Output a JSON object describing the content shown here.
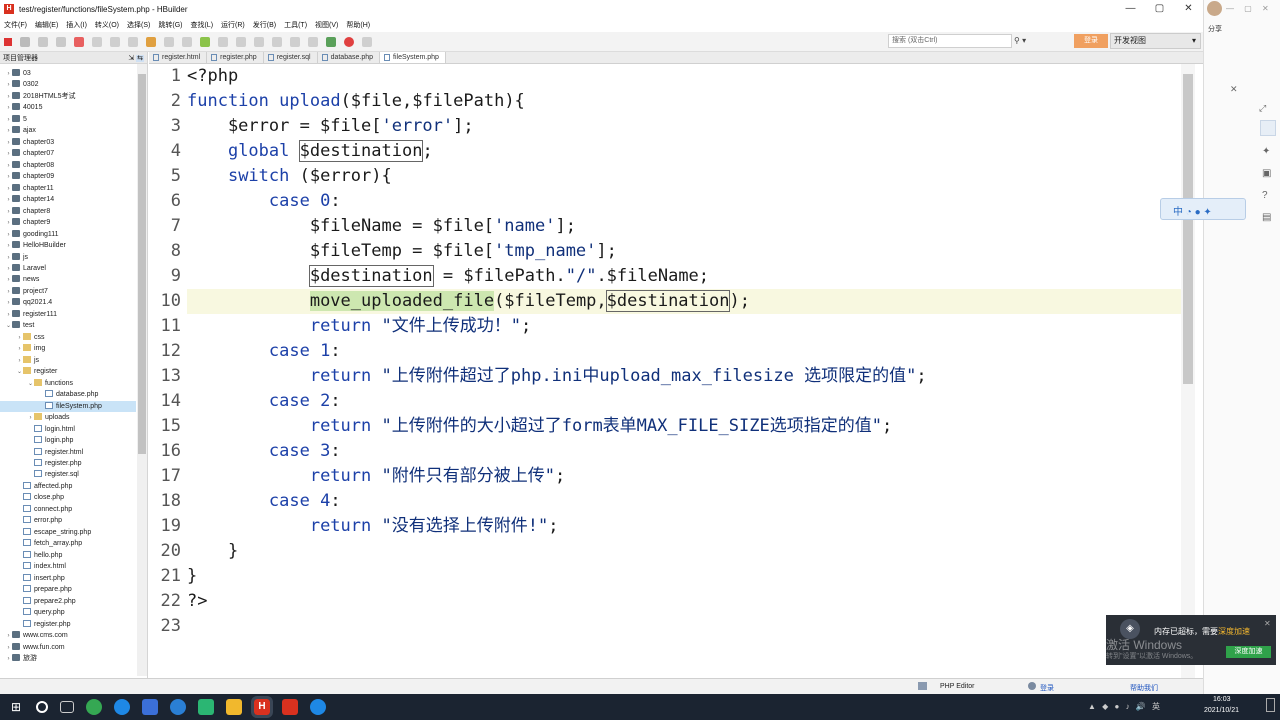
{
  "window": {
    "title": "test/register/functions/fileSystem.php - HBuilder",
    "app_icon": "H",
    "controls": [
      "—",
      "▢",
      "✕"
    ]
  },
  "menu": [
    "文件(F)",
    "编辑(E)",
    "插入(I)",
    "转义(O)",
    "选择(S)",
    "跳转(G)",
    "查找(L)",
    "运行(R)",
    "发行(B)",
    "工具(T)",
    "视图(V)",
    "帮助(H)"
  ],
  "toolbar": {
    "search_placeholder": "搜索 (双击Ctrl)",
    "login_label": "登录",
    "view_label": "开发视图"
  },
  "sidebar": {
    "title": "项目管理器",
    "items": [
      {
        "label": "03",
        "depth": 0,
        "kind": "proj",
        "arrow": "›"
      },
      {
        "label": "0302",
        "depth": 0,
        "kind": "proj",
        "arrow": "›"
      },
      {
        "label": "2018HTML5考试",
        "depth": 0,
        "kind": "proj",
        "arrow": "›"
      },
      {
        "label": "40015",
        "depth": 0,
        "kind": "proj",
        "arrow": "›"
      },
      {
        "label": "5",
        "depth": 0,
        "kind": "proj",
        "arrow": "›"
      },
      {
        "label": "ajax",
        "depth": 0,
        "kind": "proj",
        "arrow": "›"
      },
      {
        "label": "chapter03",
        "depth": 0,
        "kind": "proj",
        "arrow": "›"
      },
      {
        "label": "chapter07",
        "depth": 0,
        "kind": "proj",
        "arrow": "›"
      },
      {
        "label": "chapter08",
        "depth": 0,
        "kind": "proj",
        "arrow": "›"
      },
      {
        "label": "chapter09",
        "depth": 0,
        "kind": "proj",
        "arrow": "›"
      },
      {
        "label": "chapter11",
        "depth": 0,
        "kind": "proj",
        "arrow": "›"
      },
      {
        "label": "chapter14",
        "depth": 0,
        "kind": "proj",
        "arrow": "›"
      },
      {
        "label": "chapter8",
        "depth": 0,
        "kind": "proj",
        "arrow": "›"
      },
      {
        "label": "chapter9",
        "depth": 0,
        "kind": "proj",
        "arrow": "›"
      },
      {
        "label": "gooding111",
        "depth": 0,
        "kind": "proj",
        "arrow": "›"
      },
      {
        "label": "HelloHBuilder",
        "depth": 0,
        "kind": "proj",
        "arrow": "›"
      },
      {
        "label": "js",
        "depth": 0,
        "kind": "proj",
        "arrow": "›"
      },
      {
        "label": "Laravel",
        "depth": 0,
        "kind": "proj",
        "arrow": "›"
      },
      {
        "label": "news",
        "depth": 0,
        "kind": "proj",
        "arrow": "›"
      },
      {
        "label": "project7",
        "depth": 0,
        "kind": "proj",
        "arrow": "›"
      },
      {
        "label": "qq2021.4",
        "depth": 0,
        "kind": "proj",
        "arrow": "›"
      },
      {
        "label": "register111",
        "depth": 0,
        "kind": "proj",
        "arrow": "›"
      },
      {
        "label": "test",
        "depth": 0,
        "kind": "proj",
        "arrow": "⌄"
      },
      {
        "label": "css",
        "depth": 1,
        "kind": "folder",
        "arrow": "›"
      },
      {
        "label": "img",
        "depth": 1,
        "kind": "folder",
        "arrow": "›"
      },
      {
        "label": "js",
        "depth": 1,
        "kind": "folder",
        "arrow": "›"
      },
      {
        "label": "register",
        "depth": 1,
        "kind": "folder",
        "arrow": "⌄"
      },
      {
        "label": "functions",
        "depth": 2,
        "kind": "folder",
        "arrow": "⌄"
      },
      {
        "label": "database.php",
        "depth": 3,
        "kind": "file",
        "arrow": ""
      },
      {
        "label": "fileSystem.php",
        "depth": 3,
        "kind": "file",
        "arrow": "",
        "selected": true
      },
      {
        "label": "uploads",
        "depth": 2,
        "kind": "folder",
        "arrow": "›"
      },
      {
        "label": "login.html",
        "depth": 2,
        "kind": "file",
        "arrow": ""
      },
      {
        "label": "login.php",
        "depth": 2,
        "kind": "file",
        "arrow": ""
      },
      {
        "label": "register.html",
        "depth": 2,
        "kind": "file",
        "arrow": ""
      },
      {
        "label": "register.php",
        "depth": 2,
        "kind": "file",
        "arrow": ""
      },
      {
        "label": "register.sql",
        "depth": 2,
        "kind": "file",
        "arrow": ""
      },
      {
        "label": "affected.php",
        "depth": 1,
        "kind": "file",
        "arrow": ""
      },
      {
        "label": "close.php",
        "depth": 1,
        "kind": "file",
        "arrow": ""
      },
      {
        "label": "connect.php",
        "depth": 1,
        "kind": "file",
        "arrow": ""
      },
      {
        "label": "error.php",
        "depth": 1,
        "kind": "file",
        "arrow": ""
      },
      {
        "label": "escape_string.php",
        "depth": 1,
        "kind": "file",
        "arrow": ""
      },
      {
        "label": "fetch_array.php",
        "depth": 1,
        "kind": "file",
        "arrow": ""
      },
      {
        "label": "hello.php",
        "depth": 1,
        "kind": "file",
        "arrow": ""
      },
      {
        "label": "index.html",
        "depth": 1,
        "kind": "file",
        "arrow": ""
      },
      {
        "label": "insert.php",
        "depth": 1,
        "kind": "file",
        "arrow": ""
      },
      {
        "label": "prepare.php",
        "depth": 1,
        "kind": "file",
        "arrow": ""
      },
      {
        "label": "prepare2.php",
        "depth": 1,
        "kind": "file",
        "arrow": ""
      },
      {
        "label": "query.php",
        "depth": 1,
        "kind": "file",
        "arrow": ""
      },
      {
        "label": "register.php",
        "depth": 1,
        "kind": "file",
        "arrow": ""
      },
      {
        "label": "www.cms.com",
        "depth": 0,
        "kind": "proj",
        "arrow": "›"
      },
      {
        "label": "www.fun.com",
        "depth": 0,
        "kind": "proj",
        "arrow": "›"
      },
      {
        "label": "旅游",
        "depth": 0,
        "kind": "proj",
        "arrow": "›"
      }
    ]
  },
  "tabs": [
    {
      "label": "register.html",
      "active": false
    },
    {
      "label": "register.php",
      "active": false
    },
    {
      "label": "register.sql",
      "active": false
    },
    {
      "label": "database.php",
      "active": false
    },
    {
      "label": "fileSystem.php",
      "active": true
    }
  ],
  "editor": {
    "current_line": 10,
    "lines": [
      "<?php",
      "function upload($file,$filePath){",
      "    $error = $file['error'];",
      "    global $destination;",
      "    switch ($error){",
      "        case 0:",
      "            $fileName = $file['name'];",
      "            $fileTemp = $file['tmp_name'];",
      "            $destination = $filePath.\"/\".$fileName;",
      "            move_uploaded_file($fileTemp,$destination);",
      "            return \"文件上传成功！\";",
      "        case 1:",
      "            return \"上传附件超过了php.ini中upload_max_filesize 选项限定的值\";",
      "        case 2:",
      "            return \"上传附件的大小超过了form表单MAX_FILE_SIZE选项指定的值\";",
      "        case 3:",
      "            return \"附件只有部分被上传\";",
      "        case 4:",
      "            return \"没有选择上传附件!\";",
      "    }",
      "}",
      "?>",
      ""
    ]
  },
  "status": {
    "mode": "PHP Editor",
    "login": "登录",
    "help": "帮助我们"
  },
  "taskbar": {
    "time": "16:03",
    "date": "2021/10/21"
  },
  "notification": {
    "text": "内存已超标，需要",
    "highlight": "深度加速",
    "button": "深度加速",
    "watermark_line1": "激活 Windows",
    "watermark_line2": "转到\"设置\"以激活 Windows。"
  },
  "right_panel": {
    "share": "分享"
  }
}
